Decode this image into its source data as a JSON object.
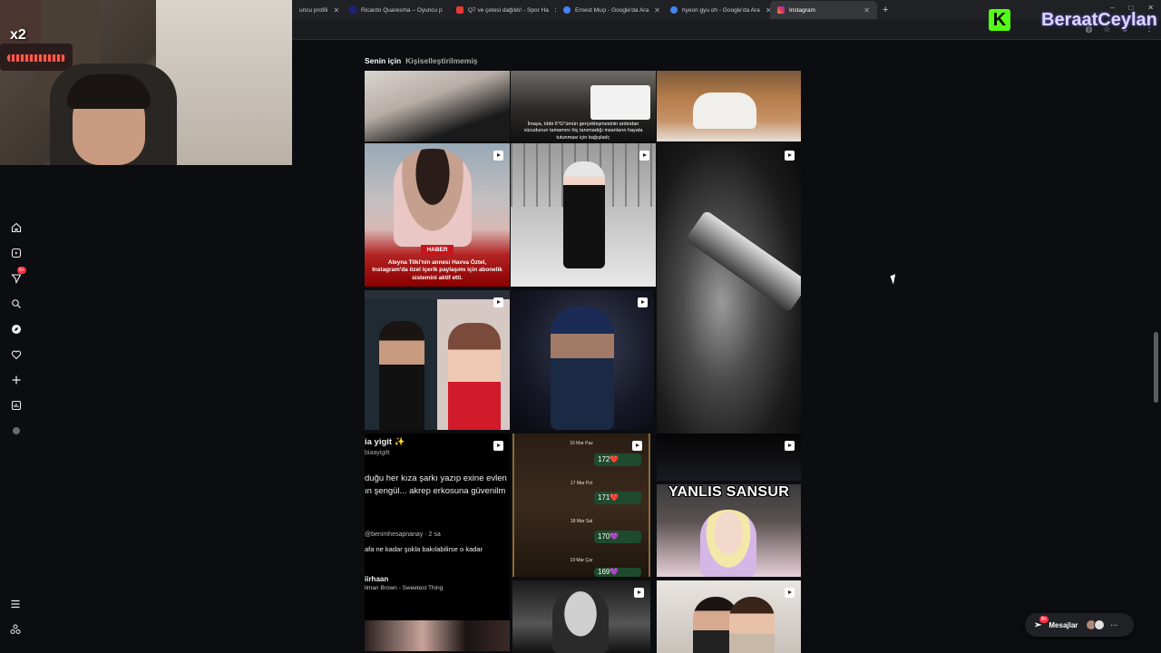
{
  "browser": {
    "tabs": [
      {
        "label": "uncu profili",
        "favicon_color": "#3f51b5",
        "active": false
      },
      {
        "label": "Ricardo Quaresma – Oyuncu p",
        "favicon_color": "#1a237e",
        "active": false
      },
      {
        "label": "Q7 ve çetesi dağıldı! - Spor Ha",
        "favicon_color": "#e53935",
        "active": false
      },
      {
        "label": "Ernest Muçi - Google'da Ara",
        "favicon_color": "#4285f4",
        "active": false
      },
      {
        "label": "hyeon gyu oh - Google'da Ara",
        "favicon_color": "#4285f4",
        "active": false
      },
      {
        "label": "Instagram",
        "favicon_color": "#e1306c",
        "active": true
      }
    ],
    "new_tab": "+",
    "close_glyph": "✕",
    "window_controls": [
      "–",
      "□",
      "✕"
    ]
  },
  "overlay": {
    "multiplier": "x2",
    "platform_logo": "K",
    "streamer_name": "BeraatCeylan"
  },
  "instagram": {
    "filters": {
      "active": "Senin için",
      "inactive": "Kişiselleştirilmemiş"
    },
    "nav_badge": "9+",
    "tiles": {
      "t2_caption": "İmaya, tıbbi 6°G°ümün gerçekleşmesinin ardından vücudunun tamamını hiç tanımadığı insanların hayata tutunması için bağışladı;",
      "t4_badge": "HABER",
      "t4_headline": "Aleyna Tilki'nin annesi Havva Öztel, Instagram'da özel içerik paylaşımı için abonelik sistemini aktif etti.",
      "t9_lines": [
        "ia yigit ✨",
        "biaayigitt",
        "duğu her kıza şarkı yazıp exine evlen",
        "ın şengül... akrep erkosuna güvenilm",
        "@benimhesapnanay · 2 sa",
        "afa ne kadar şokla bakılabilirse o kadar",
        "iirhaan",
        "llman Brown - Sweetest Thing"
      ],
      "t10_dates": [
        "16 Mar Paz",
        "17 Mar Pzt",
        "18 Mar Sal",
        "19 Mar Çar"
      ],
      "t10_counts": [
        "172❤️",
        "171❤️",
        "170💜",
        "169💜"
      ],
      "t12_title": "YANLIS SANSUR"
    },
    "messages": {
      "label": "Mesajlar",
      "badge": "9+"
    }
  },
  "icons": [
    "home-icon",
    "reels-icon",
    "messages-icon",
    "search-icon",
    "explore-icon",
    "heart-icon",
    "create-icon",
    "dashboard-icon",
    "profile-icon",
    "menu-icon",
    "meta-icon"
  ]
}
